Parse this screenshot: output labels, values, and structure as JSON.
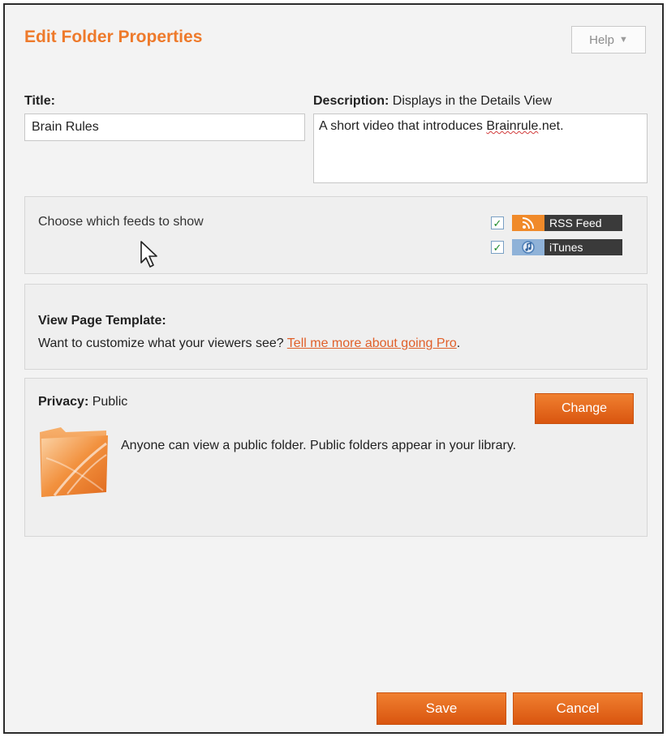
{
  "dialog": {
    "title": "Edit Folder Properties",
    "help_label": "Help",
    "help_caret": "▼"
  },
  "fields": {
    "title_label": "Title:",
    "title_value": "Brain Rules",
    "description_label": "Description:",
    "description_hint": " Displays in the Details View",
    "description_value_pre": "A short video that introduces ",
    "description_value_misspelled": "Brainrule",
    "description_value_post": ".net."
  },
  "feeds": {
    "prompt": "Choose which feeds to show",
    "items": [
      {
        "label": "RSS Feed",
        "checked": true,
        "icon": "rss-icon"
      },
      {
        "label": "iTunes",
        "checked": true,
        "icon": "itunes-icon"
      }
    ]
  },
  "template": {
    "heading": "View Page Template:",
    "text": "Want to customize what your viewers see? ",
    "link": "Tell me more about going Pro",
    "trail": "."
  },
  "privacy": {
    "label": "Privacy:",
    "value": " Public",
    "change_label": "Change",
    "description": "Anyone can view a public folder. Public folders appear in your library.",
    "icon": "folder-icon"
  },
  "actions": {
    "save_label": "Save",
    "cancel_label": "Cancel"
  },
  "colors": {
    "accent": "#ee7a2b",
    "button": "#e06a1e",
    "link": "#e0602a"
  }
}
